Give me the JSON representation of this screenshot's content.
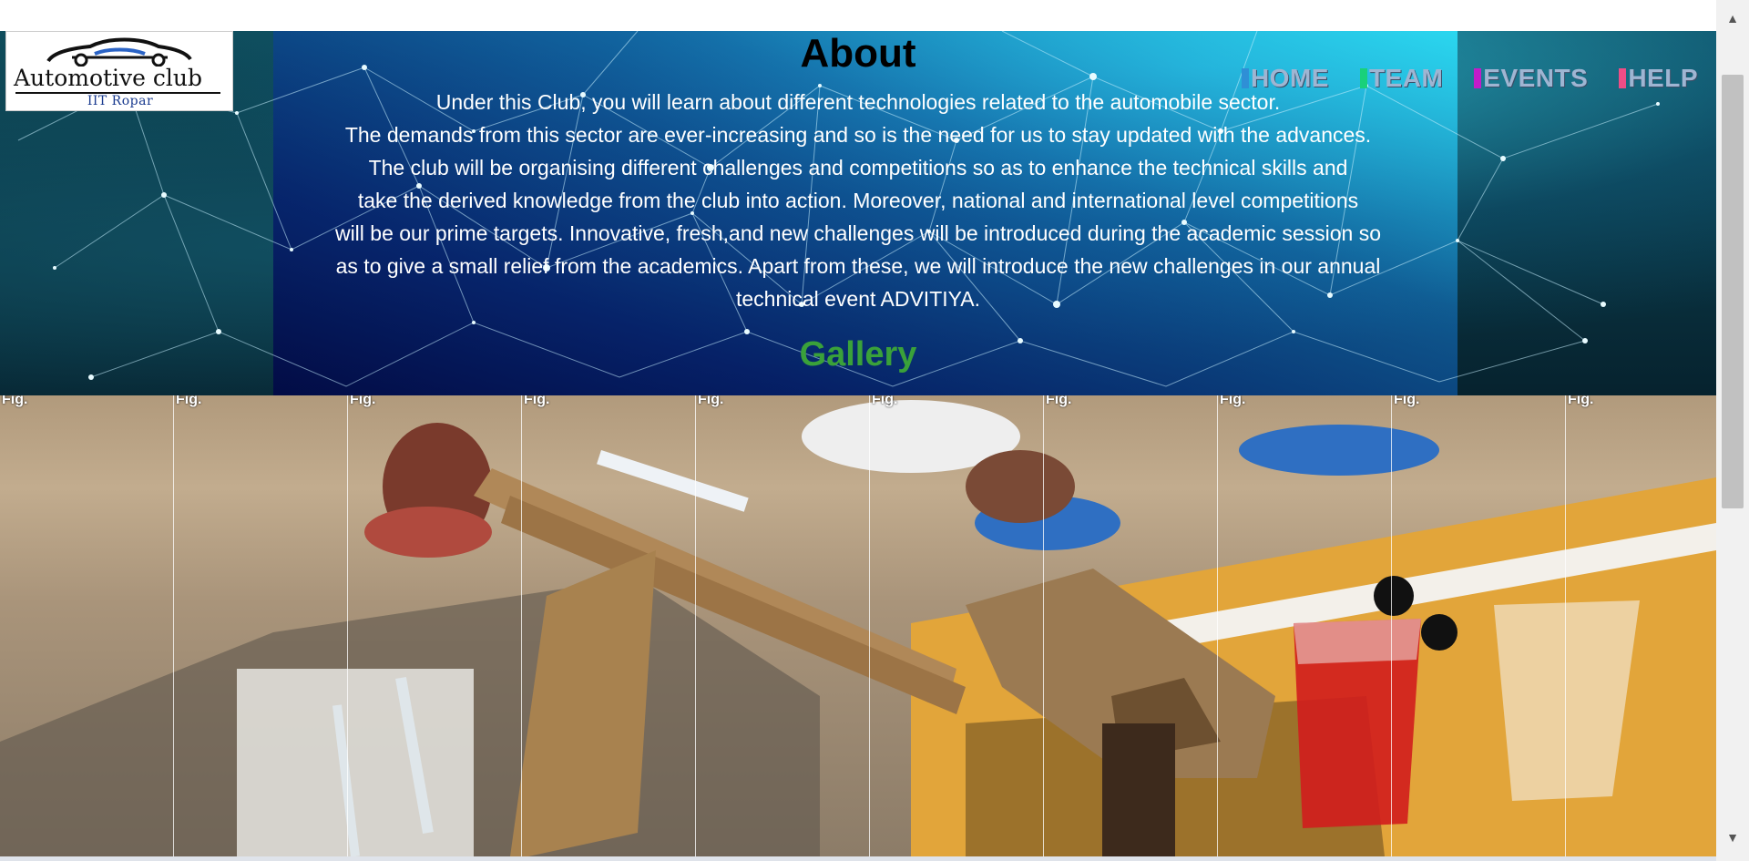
{
  "brand": {
    "logo_title": "Automotive club",
    "logo_subtitle": "IIT Ropar"
  },
  "nav": {
    "items": [
      {
        "label": "HOME",
        "accent": "#2f8fd6"
      },
      {
        "label": "TEAM",
        "accent": "#19d17a"
      },
      {
        "label": "EVENTS",
        "accent": "#c21cc9"
      },
      {
        "label": "HELP",
        "accent": "#ee4d86"
      }
    ]
  },
  "about": {
    "title": "About",
    "lines": [
      "Under this Club, you will learn about different technologies related to the automobile sector.",
      "The demands from this sector are ever-increasing and so is the need for us to stay updated with the advances.",
      "The club will be organising different challenges and competitions so as to enhance the technical skills and",
      "take the derived knowledge from the club into action. Moreover, national and international level competitions",
      "will be our prime targets. Innovative, fresh,and new challenges will be introduced during the academic session so",
      "as to give a small relief from the academics. Apart from these, we will introduce the new challenges in our annual",
      "technical event ADVITIYA."
    ]
  },
  "gallery": {
    "title": "Gallery",
    "figures": [
      {
        "label": "Fig."
      },
      {
        "label": "Fig."
      },
      {
        "label": "Fig."
      },
      {
        "label": "Fig."
      },
      {
        "label": "Fig."
      },
      {
        "label": "Fig."
      },
      {
        "label": "Fig."
      },
      {
        "label": "Fig."
      },
      {
        "label": "Fig."
      },
      {
        "label": "Fig."
      }
    ]
  },
  "colors": {
    "gallery_title": "#3aa13a",
    "nav_text": "#9fb5d2"
  }
}
